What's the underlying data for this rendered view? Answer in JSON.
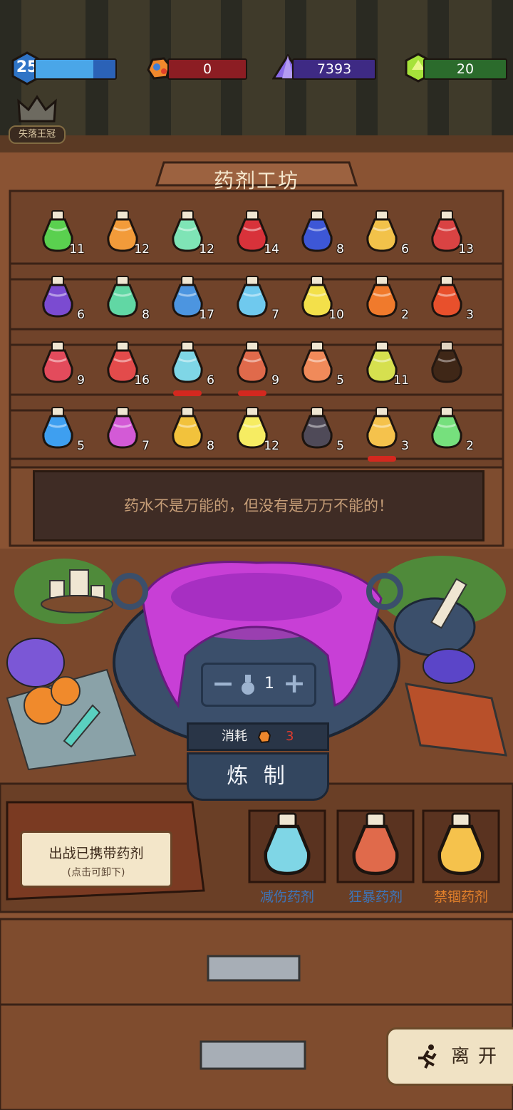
{
  "hud": {
    "level": "25",
    "level_progress": 0.72,
    "ore": "0",
    "crystals": "7393",
    "gems": "20"
  },
  "crown": {
    "label": "失落王冠"
  },
  "workshop": {
    "title": "药剂工坊"
  },
  "potions": [
    {
      "count": "11",
      "color": "#5ad04f",
      "equipped": false
    },
    {
      "count": "12",
      "color": "#f29b3a",
      "equipped": false
    },
    {
      "count": "12",
      "color": "#7fe4b6",
      "equipped": false
    },
    {
      "count": "14",
      "color": "#d8323a",
      "equipped": false
    },
    {
      "count": "8",
      "color": "#3d57d6",
      "equipped": false
    },
    {
      "count": "6",
      "color": "#f2c24a",
      "equipped": false
    },
    {
      "count": "13",
      "color": "#d94343",
      "equipped": false
    },
    {
      "count": "6",
      "color": "#7b4bd1",
      "equipped": false
    },
    {
      "count": "8",
      "color": "#61d7a4",
      "equipped": false
    },
    {
      "count": "17",
      "color": "#4c95e0",
      "equipped": false
    },
    {
      "count": "7",
      "color": "#6fc9ee",
      "equipped": false
    },
    {
      "count": "10",
      "color": "#f3e04a",
      "equipped": false
    },
    {
      "count": "2",
      "color": "#f07a2c",
      "equipped": false
    },
    {
      "count": "3",
      "color": "#e8502c",
      "equipped": false
    },
    {
      "count": "9",
      "color": "#e34b5c",
      "equipped": false
    },
    {
      "count": "16",
      "color": "#e34b4b",
      "equipped": false
    },
    {
      "count": "6",
      "color": "#7fd6e6",
      "equipped": true
    },
    {
      "count": "9",
      "color": "#e06a4b",
      "equipped": true
    },
    {
      "count": "5",
      "color": "#f08a5a",
      "equipped": false
    },
    {
      "count": "11",
      "color": "#d6e04f",
      "equipped": false
    },
    {
      "count": "",
      "color": "#3a2416",
      "equipped": false
    },
    {
      "count": "5",
      "color": "#3e9ff0",
      "equipped": false
    },
    {
      "count": "7",
      "color": "#d35ad6",
      "equipped": false
    },
    {
      "count": "8",
      "color": "#f2c23c",
      "equipped": false
    },
    {
      "count": "12",
      "color": "#f6ec62",
      "equipped": false
    },
    {
      "count": "5",
      "color": "#4f4a58",
      "equipped": false
    },
    {
      "count": "3",
      "color": "#f5c24c",
      "equipped": true
    },
    {
      "count": "2",
      "color": "#76e07d",
      "equipped": false
    }
  ],
  "message": "药水不是万能的，但没有是万万不能的！",
  "cauldron": {
    "quantity": "1",
    "cost_label": "消耗",
    "cost_value": "3",
    "craft_label": "炼 制"
  },
  "carry": {
    "title": "出战已携带药剂",
    "subtitle": "(点击可卸下)"
  },
  "equipped_slots": [
    {
      "label": "减伤药剂",
      "color": "#7fd6e6",
      "label_color": "#3d74b8"
    },
    {
      "label": "狂暴药剂",
      "color": "#e06a4b",
      "label_color": "#3d74b8"
    },
    {
      "label": "禁锢药剂",
      "color": "#f5c24c",
      "label_color": "#e07f2a"
    }
  ],
  "leave": {
    "label": "离开"
  },
  "colors": {
    "wood": "#8a5333",
    "wood_dark": "#5a3320",
    "goo": "#c83fd6",
    "cauldron": "#3b4f6b"
  }
}
